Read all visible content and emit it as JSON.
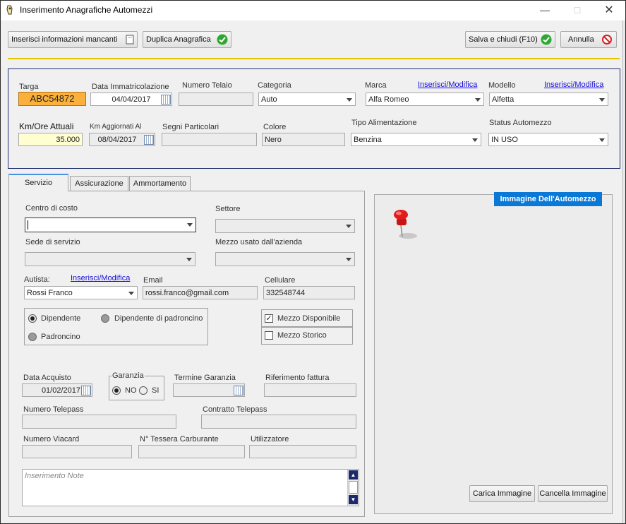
{
  "window": {
    "title": "Inserimento Anagrafiche Automezzi"
  },
  "toolbar": {
    "insert_missing": "Inserisci informazioni mancanti",
    "duplicate": "Duplica Anagrafica",
    "save_close": "Salva e chiudi (F10)",
    "cancel": "Annulla"
  },
  "header": {
    "targa_label": "Targa",
    "targa_value": "ABC54872",
    "data_imm_label": "Data Immatricolazione",
    "data_imm_value": "04/04/2017",
    "telaio_label": "Numero Telaio",
    "telaio_value": "",
    "categoria_label": "Categoria",
    "categoria_value": "Auto",
    "marca_label": "Marca",
    "marca_link": "Inserisci/Modifica",
    "marca_value": "Alfa Romeo",
    "modello_label": "Modello",
    "modello_link": "Inserisci/Modifica",
    "modello_value": "Alfetta",
    "km_label": "Km/Ore Attuali",
    "km_value": "35.000",
    "km_agg_label": "Km Aggiornati Al",
    "km_agg_value": "08/04/2017",
    "segni_label": "Segni Particolari",
    "segni_value": "",
    "colore_label": "Colore",
    "colore_value": "Nero",
    "alimentazione_label": "Tipo Alimentazione",
    "alimentazione_value": "Benzina",
    "status_label": "Status Automezzo",
    "status_value": "IN USO"
  },
  "tabs": [
    {
      "label": "Servizio"
    },
    {
      "label": "Assicurazione"
    },
    {
      "label": "Ammortamento"
    }
  ],
  "servizio": {
    "centro_label": "Centro di costo",
    "centro_value": "",
    "settore_label": "Settore",
    "settore_value": "",
    "sede_label": "Sede di servizio",
    "sede_value": "",
    "mezzo_usato_label": "Mezzo usato dall'azienda",
    "mezzo_usato_value": "",
    "autista_label": "Autista:",
    "autista_link": "Inserisci/Modifica",
    "autista_value": "Rossi Franco",
    "email_label": "Email",
    "email_value": "rossi.franco@gmail.com",
    "cellulare_label": "Cellulare",
    "cellulare_value": "332548744",
    "radio_dipendente": "Dipendente",
    "radio_dip_padroncino": "Dipendente di padroncino",
    "radio_padroncino": "Padroncino",
    "check_disponibile": "Mezzo Disponibile",
    "check_storico": "Mezzo Storico",
    "data_acquisto_label": "Data Acquisto",
    "data_acquisto_value": "01/02/2017",
    "garanzia_label": "Garanzia",
    "garanzia_no": "NO",
    "garanzia_si": "SI",
    "termine_label": "Termine Garanzia",
    "termine_value": "",
    "rif_fattura_label": "Riferimento fattura",
    "rif_fattura_value": "",
    "telepass_label": "Numero Telepass",
    "telepass_value": "",
    "contratto_label": "Contratto Telepass",
    "contratto_value": "",
    "viacard_label": "Numero Viacard",
    "viacard_value": "",
    "tessera_label": "N° Tessera Carburante",
    "tessera_value": "",
    "utilizzatore_label": "Utilizzatore",
    "utilizzatore_value": "",
    "note_placeholder": "Inserimento Note"
  },
  "image_panel": {
    "title": "Immagine Dell'Automezzo",
    "load": "Carica Immagine",
    "delete": "Cancella Immagine"
  },
  "colors": {
    "accent_blue": "#0a78d7",
    "targa_bg": "#fbb03b",
    "km_bg": "#fffed0",
    "panel_border": "#1d2b6e",
    "yellow_line": "#e3c300"
  },
  "icons": [
    "app-icon",
    "document-icon",
    "check-green-icon",
    "cancel-red-icon",
    "pushpin-icon",
    "calendar-icon"
  ]
}
